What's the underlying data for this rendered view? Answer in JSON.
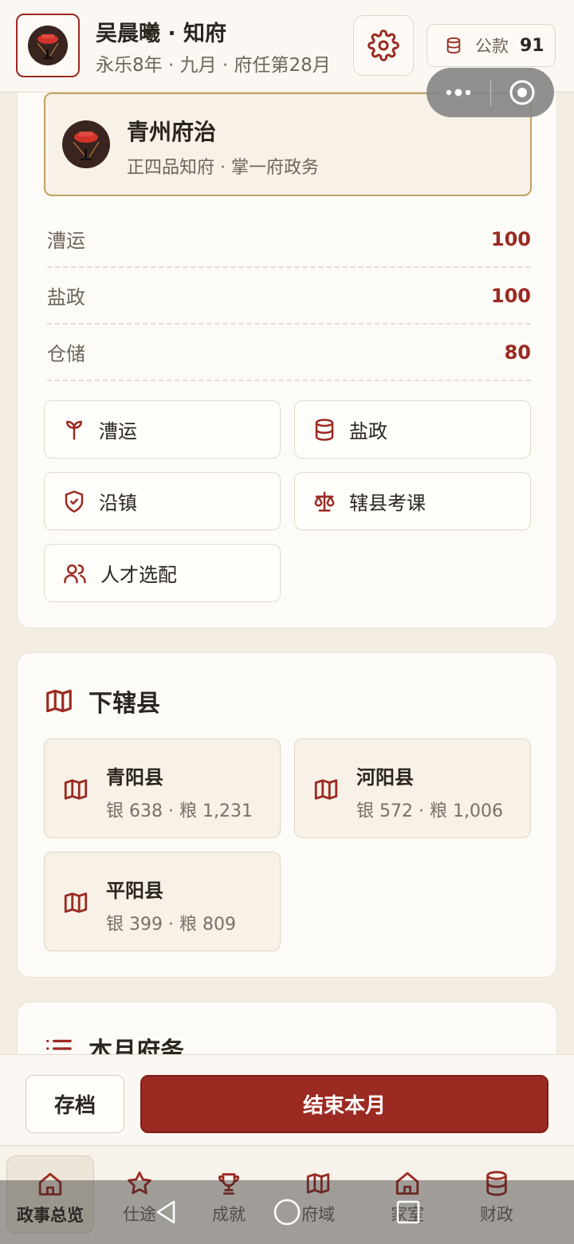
{
  "header": {
    "name": "吴晨曦 · 知府",
    "date": "永乐8年 · 九月 · 府任第28月",
    "funds_label": "公款",
    "funds_value": "91"
  },
  "office": {
    "title": "青州府治",
    "subtitle": "正四品知府 · 掌一府政务"
  },
  "stats": [
    {
      "label": "漕运",
      "value": "100"
    },
    {
      "label": "盐政",
      "value": "100"
    },
    {
      "label": "仓储",
      "value": "80"
    }
  ],
  "actions": [
    {
      "label": "漕运",
      "icon": "sprout-icon"
    },
    {
      "label": "盐政",
      "icon": "database-icon"
    },
    {
      "label": "沿镇",
      "icon": "shield-check-icon"
    },
    {
      "label": "辖县考课",
      "icon": "scales-icon"
    },
    {
      "label": "人才选配",
      "icon": "users-icon"
    }
  ],
  "counties_section": {
    "title": "下辖县",
    "items": [
      {
        "name": "青阳县",
        "resources": "银 638 · 粮 1,231"
      },
      {
        "name": "河阳县",
        "resources": "银 572 · 粮 1,006"
      },
      {
        "name": "平阳县",
        "resources": "银 399 · 粮 809"
      }
    ]
  },
  "monthly_section": {
    "title": "本月府务"
  },
  "footer": {
    "save_label": "存档",
    "end_label": "结束本月"
  },
  "tabs": [
    {
      "label": "政事总览",
      "icon": "home-icon",
      "active": true
    },
    {
      "label": "仕途",
      "icon": "star-icon"
    },
    {
      "label": "成就",
      "icon": "trophy-icon"
    },
    {
      "label": "府域",
      "icon": "map-icon"
    },
    {
      "label": "家室",
      "icon": "house-icon"
    },
    {
      "label": "财政",
      "icon": "database-icon"
    }
  ],
  "colors": {
    "accent": "#9b2a22",
    "gold_border": "#c0a262",
    "background": "#f3ede3",
    "card": "#fdfbf7"
  }
}
